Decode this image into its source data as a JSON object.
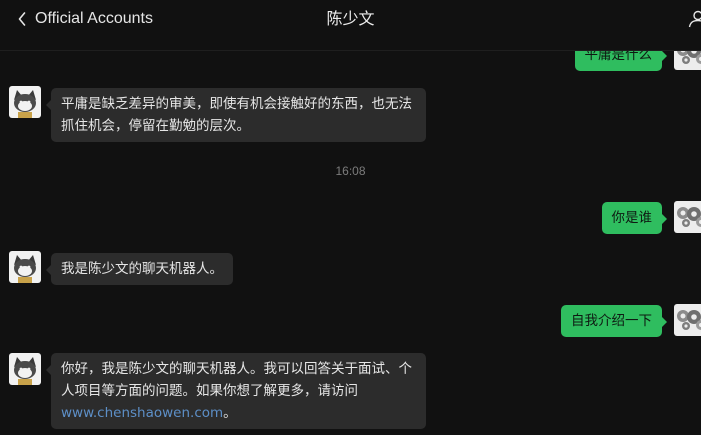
{
  "header": {
    "back_label": "Official Accounts",
    "title": "陈少文"
  },
  "colors": {
    "background": "#111111",
    "bubble_incoming": "#2c2c2c",
    "bubble_outgoing": "#2fbd5f",
    "link": "#5d8fc7"
  },
  "messages": [
    {
      "side": "out",
      "text": "平庸是什么"
    },
    {
      "side": "in",
      "text": "平庸是缺乏差异的审美，即使有机会接触好的东西，也无法抓住机会，停留在勤勉的层次。"
    },
    {
      "side": "time",
      "text": "16:08"
    },
    {
      "side": "out",
      "text": "你是谁"
    },
    {
      "side": "in",
      "text": "我是陈少文的聊天机器人。"
    },
    {
      "side": "out",
      "text": "自我介绍一下"
    },
    {
      "side": "in",
      "text_before_link": "你好，我是陈少文的聊天机器人。我可以回答关于面试、个人项目等方面的问题。如果你想了解更多，请访问",
      "link": "www.chenshaowen.com",
      "text_after_link": "。"
    }
  ],
  "icons": {
    "back": "chevron-left-icon",
    "profile": "person-icon",
    "bot_avatar": "cat-avatar",
    "user_avatar": "gears-avatar"
  }
}
